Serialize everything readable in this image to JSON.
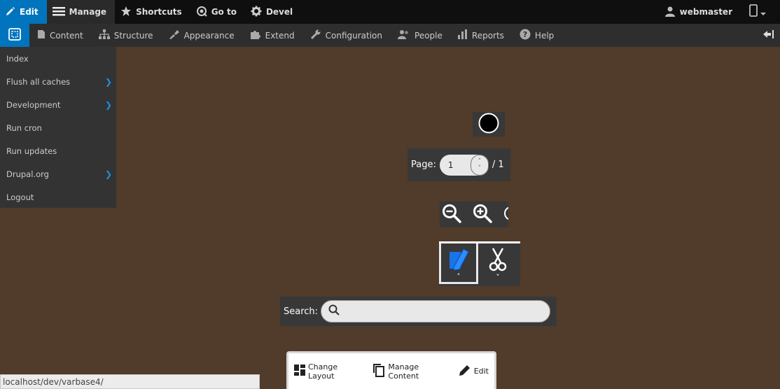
{
  "toolbar": {
    "edit_label": "Edit",
    "manage_label": "Manage",
    "shortcuts_label": "Shortcuts",
    "goto_label": "Go to",
    "devel_label": "Devel",
    "user_label": "webmaster"
  },
  "tray": {
    "items": [
      "Content",
      "Structure",
      "Appearance",
      "Extend",
      "Configuration",
      "People",
      "Reports",
      "Help"
    ]
  },
  "devel_menu": {
    "items": [
      "Index",
      "Flush all caches",
      "Development",
      "Run cron",
      "Run updates",
      "Drupal.org",
      "Logout"
    ]
  },
  "viewer": {
    "page_label": "Page:",
    "page_value": "1",
    "page_total": "/ 1",
    "search_label": "Search:"
  },
  "layout_builder": {
    "change_layout": "Change Layout",
    "manage_content": "Manage Content",
    "edit": "Edit"
  },
  "statusbar": {
    "url": "localhost/dev/varbase4/"
  },
  "colors": {
    "accent": "#0074bd",
    "background": "#513b2a",
    "toolbar": "#0f0f0f",
    "tray": "#2e2e2e"
  }
}
